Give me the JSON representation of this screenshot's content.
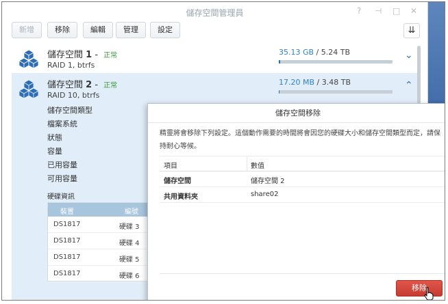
{
  "window": {
    "title": "儲存空間管理員",
    "controls": [
      "?",
      "–",
      "□",
      "✕"
    ]
  },
  "toolbar": {
    "buttons": [
      {
        "label": "新增",
        "disabled": true
      },
      {
        "label": "移除",
        "disabled": false
      },
      {
        "label": "編輯",
        "disabled": false
      },
      {
        "label": "管理",
        "disabled": false
      },
      {
        "label": "設定",
        "disabled": false
      }
    ],
    "sort_icon": "sort-icon"
  },
  "pools": [
    {
      "name": "儲存空間",
      "number": "1",
      "dash": " - ",
      "status": "正常",
      "raid": "RAID 1, btrfs",
      "used": "35.13 GB",
      "total": " / 5.24 TB",
      "fill_fraction": 0.01,
      "expanded": false
    },
    {
      "name": "儲存空間",
      "number": "2",
      "dash": " - ",
      "status": "正常",
      "raid": "RAID 10, btrfs",
      "used": "17.20 MB",
      "total": " / 3.48 TB",
      "fill_fraction": 0.0,
      "expanded": true
    }
  ],
  "detail": {
    "labels": [
      "儲存空間類型",
      "檔案系統",
      "狀態",
      "容量",
      "已用容量",
      "可用容量"
    ],
    "disk_info_title": "硬碟資訊",
    "disk_columns": [
      "裝置",
      "編號"
    ],
    "disks": [
      {
        "device": "DS1817",
        "id": "硬碟 3"
      },
      {
        "device": "DS1817",
        "id": "硬碟 4"
      },
      {
        "device": "DS1817",
        "id": "硬碟 5"
      },
      {
        "device": "DS1817",
        "id": "硬碟 6"
      }
    ]
  },
  "dialog": {
    "title": "儲存空間移除",
    "message": "精靈將會移除下列設定。這個動作需要的時間將會因您的硬碟大小和儲存空間類型而定，請保持耐心等候。",
    "columns": [
      "項目",
      "數值"
    ],
    "rows": [
      {
        "item": "儲存空間",
        "value": "儲存空間 2"
      },
      {
        "item": "共用資料夾",
        "value": "share02"
      }
    ],
    "remove_label": "移除"
  },
  "colors": {
    "accent": "#1f6fbf",
    "status_ok": "#3c9b3c",
    "danger": "#d0463c",
    "selected_bg": "#e1edf8"
  }
}
